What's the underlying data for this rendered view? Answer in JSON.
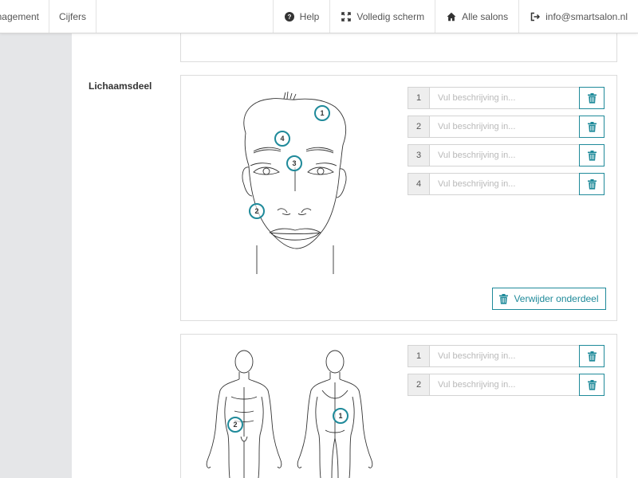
{
  "nav": {
    "left": [
      "nagement",
      "Cijfers"
    ],
    "right": [
      {
        "icon": "question-icon",
        "label": "Help"
      },
      {
        "icon": "fullscreen-icon",
        "label": "Volledig scherm"
      },
      {
        "icon": "home-icon",
        "label": "Alle salons"
      },
      {
        "icon": "logout-icon",
        "label": "info@smartsalon.nl"
      }
    ]
  },
  "section": {
    "label": "Lichaamsdeel"
  },
  "face_part": {
    "rows": [
      {
        "num": "1",
        "placeholder": "Vul beschrijving in..."
      },
      {
        "num": "2",
        "placeholder": "Vul beschrijving in..."
      },
      {
        "num": "3",
        "placeholder": "Vul beschrijving in..."
      },
      {
        "num": "4",
        "placeholder": "Vul beschrijving in..."
      }
    ],
    "markers": [
      "1",
      "4",
      "3",
      "2"
    ],
    "remove_label": "Verwijder onderdeel"
  },
  "body_part": {
    "rows": [
      {
        "num": "1",
        "placeholder": "Vul beschrijving in..."
      },
      {
        "num": "2",
        "placeholder": "Vul beschrijving in..."
      }
    ],
    "markers": [
      "2",
      "1"
    ]
  },
  "colors": {
    "accent": "#1f8a9a",
    "background": "#e5e6e8"
  }
}
